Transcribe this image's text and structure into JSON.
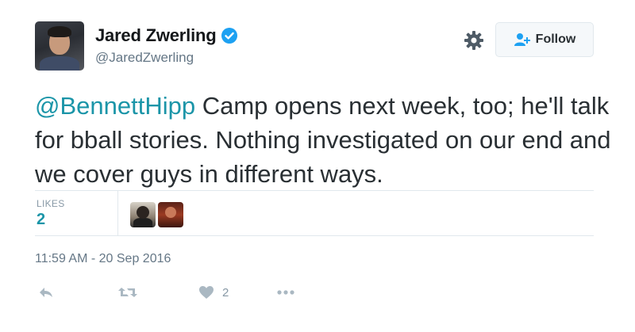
{
  "user": {
    "display_name": "Jared Zwerling",
    "handle": "@JaredZwerling",
    "verified": true
  },
  "header": {
    "follow_label": "Follow"
  },
  "tweet": {
    "mention": "@BennettHipp",
    "text": " Camp opens next week, too; he'll talk for bball stories. Nothing investigated on our end and we cover guys in different ways."
  },
  "stats": {
    "likes_label": "LIKES",
    "likes_count": "2"
  },
  "timestamp": "11:59 AM - 20 Sep 2016",
  "actions": {
    "like_count": "2"
  },
  "icons": {
    "verified": "verified-badge-icon",
    "settings": "gear-icon",
    "follow": "follow-person-icon",
    "reply": "reply-icon",
    "retweet": "retweet-icon",
    "like": "heart-icon",
    "more": "more-dots-icon"
  },
  "colors": {
    "accent": "#1b95a8",
    "verified": "#1da1f2",
    "muted": "#657786",
    "icon": "#aab8c2"
  }
}
